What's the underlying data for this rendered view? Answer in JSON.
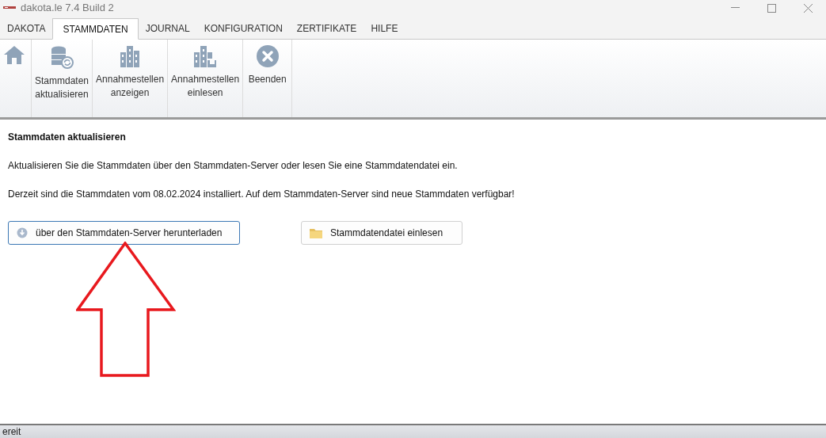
{
  "window": {
    "title": "dakota.le 7.4 Build 2"
  },
  "tabs": [
    {
      "label": "DAKOTA",
      "selected": false
    },
    {
      "label": "STAMMDATEN",
      "selected": true
    },
    {
      "label": "JOURNAL",
      "selected": false
    },
    {
      "label": "KONFIGURATION",
      "selected": false
    },
    {
      "label": "ZERTIFIKATE",
      "selected": false
    },
    {
      "label": "HILFE",
      "selected": false
    }
  ],
  "ribbon": [
    {
      "kind": "home"
    },
    {
      "kind": "database",
      "label": [
        "Stammdaten",
        "aktualisieren"
      ]
    },
    {
      "kind": "buildings",
      "label": [
        "Annahmestellen",
        "anzeigen"
      ]
    },
    {
      "kind": "buildings-import",
      "label": [
        "Annahmestellen",
        "einlesen"
      ]
    },
    {
      "kind": "close",
      "label": [
        "Beenden"
      ]
    }
  ],
  "content": {
    "heading": "Stammdaten aktualisieren",
    "paragraphs": [
      "Aktualisieren Sie die Stammdaten über den Stammdaten-Server oder lesen Sie eine Stammdatendatei ein.",
      "Derzeit sind die Stammdaten vom 08.02.2024 installiert. Auf dem Stammdaten-Server sind neue Stammdaten verfügbar!"
    ],
    "buttons": [
      {
        "kind": "download",
        "label": "über den Stammdaten-Server herunterladen",
        "selected": true
      },
      {
        "kind": "folder",
        "label": "Stammdatendatei einlesen",
        "selected": false
      }
    ]
  },
  "status_bar": {
    "text": "ereit"
  }
}
